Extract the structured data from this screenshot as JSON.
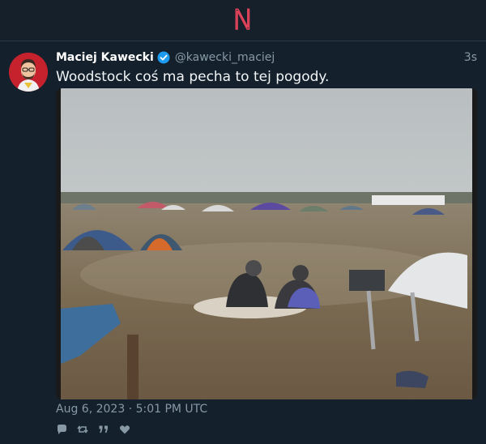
{
  "app": {
    "logo_letter": "N",
    "brand_color": "#e0435a"
  },
  "tweet": {
    "author_name": "Maciej Kawecki",
    "author_handle": "@kawecki_maciej",
    "relative_time": "3s",
    "verified": true,
    "text": "Woodstock coś ma pecha to tej pogody.",
    "timestamp": "Aug 6, 2023 · 5:01 PM UTC",
    "media": {
      "kind": "photo",
      "description_icon": "photo"
    }
  },
  "actions": [
    {
      "name": "reply-icon"
    },
    {
      "name": "retweet-icon"
    },
    {
      "name": "quote-icon"
    },
    {
      "name": "like-icon"
    }
  ],
  "colors": {
    "background": "#14202b",
    "verified_blue": "#1d9bf0",
    "secondary_text": "#8899a6"
  }
}
